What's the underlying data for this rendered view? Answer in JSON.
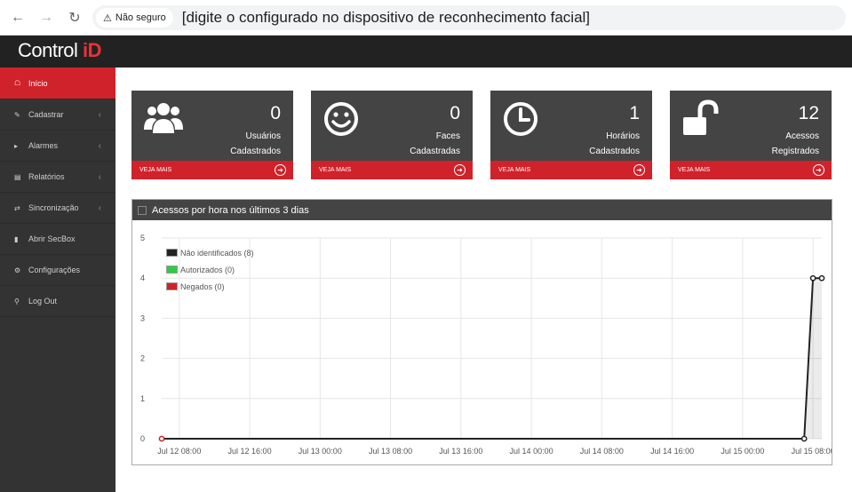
{
  "browser": {
    "security_label": "Não seguro",
    "url": "[digite o configurado no dispositivo de reconhecimento facial]"
  },
  "header": {
    "brand_main": "Control ",
    "brand_accent": "iD"
  },
  "sidebar": {
    "items": [
      {
        "label": "Início",
        "icon": "home-icon",
        "active": true,
        "chevron": false
      },
      {
        "label": "Cadastrar",
        "icon": "edit-icon",
        "active": false,
        "chevron": true
      },
      {
        "label": "Alarmes",
        "icon": "megaphone-icon",
        "active": false,
        "chevron": true
      },
      {
        "label": "Relatórios",
        "icon": "bar-chart-icon",
        "active": false,
        "chevron": true
      },
      {
        "label": "Sincronização",
        "icon": "shuffle-icon",
        "active": false,
        "chevron": true
      },
      {
        "label": "Abrir SecBox",
        "icon": "columns-icon",
        "active": false,
        "chevron": false
      },
      {
        "label": "Configurações",
        "icon": "gears-icon",
        "active": false,
        "chevron": false
      },
      {
        "label": "Log Out",
        "icon": "key-icon",
        "active": false,
        "chevron": false
      }
    ]
  },
  "cards": [
    {
      "value": "0",
      "label1": "Usuários",
      "label2": "Cadastrados",
      "footer": "VEJA MAIS",
      "icon": "users-icon"
    },
    {
      "value": "0",
      "label1": "Faces",
      "label2": "Cadastradas",
      "footer": "VEJA MAIS",
      "icon": "smile-icon"
    },
    {
      "value": "1",
      "label1": "Horários",
      "label2": "Cadastrados",
      "footer": "VEJA MAIS",
      "icon": "clock-icon"
    },
    {
      "value": "12",
      "label1": "Acessos",
      "label2": "Registrados",
      "footer": "VEJA MAIS",
      "icon": "unlock-icon"
    }
  ],
  "colors": {
    "accent": "#d0222b",
    "card_bg": "#444444",
    "sidebar_bg": "#333333"
  },
  "chart_data": {
    "type": "line",
    "title": "Acessos por hora nos últimos 3 dias",
    "xlabel": "",
    "ylabel": "",
    "ylim": [
      0,
      5
    ],
    "yticks": [
      0,
      1,
      2,
      3,
      4,
      5
    ],
    "xticks": [
      "Jul 12 08:00",
      "Jul 12 16:00",
      "Jul 13 00:00",
      "Jul 13 08:00",
      "Jul 13 16:00",
      "Jul 14 00:00",
      "Jul 14 08:00",
      "Jul 14 16:00",
      "Jul 15 00:00",
      "Jul 15 08:00"
    ],
    "xrange": [
      "Jul 12 06:00",
      "Jul 15 09:00"
    ],
    "grid": true,
    "legend_position": "top-left",
    "series": [
      {
        "name": "Não identificados (8)",
        "color": "#222222",
        "x": [
          "Jul 12 06:00",
          "Jul 15 07:00",
          "Jul 15 08:00",
          "Jul 15 09:00"
        ],
        "y": [
          0,
          0,
          4,
          4
        ]
      },
      {
        "name": "Autorizados (0)",
        "color": "#2ecc40",
        "x": [],
        "y": []
      },
      {
        "name": "Negados (0)",
        "color": "#d0222b",
        "x": [],
        "y": []
      }
    ]
  }
}
